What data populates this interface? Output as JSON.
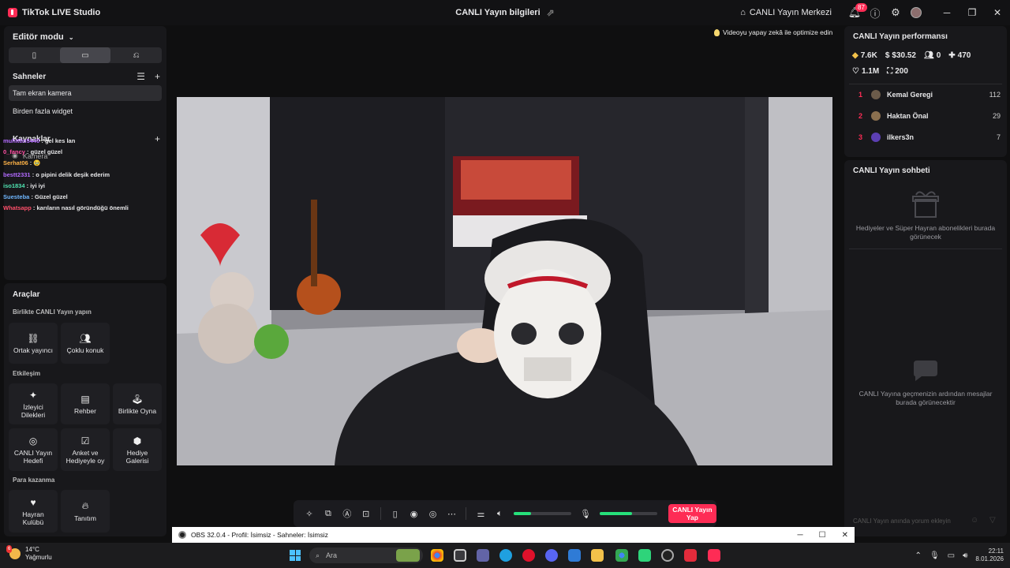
{
  "app": {
    "title": "TikTok LIVE Studio"
  },
  "header": {
    "center_title": "CANLI Yayın bilgileri",
    "live_center": "CANLI Yayın Merkezi",
    "notification_count": "87"
  },
  "editor": {
    "mode_label": "Editör modu",
    "scenes_title": "Sahneler",
    "scenes": [
      "Tam ekran kamera",
      "Birden fazla widget"
    ],
    "sources_title": "Kaynaklar",
    "source_camera": "Kamera"
  },
  "chat_overlay": [
    {
      "user": "muhittin5440",
      "text": "gel kes lan",
      "color": "#b36bff"
    },
    {
      "user": "0_fancy",
      "text": "güzel güzel",
      "color": "#ff4fa3"
    },
    {
      "user": "Serhat06",
      "text": "🥹",
      "color": "#ffb347"
    },
    {
      "user": "bestt2331",
      "text": "o pipini delik deşik ederim",
      "color": "#b36bff"
    },
    {
      "user": "iso1834",
      "text": "iyi iyi",
      "color": "#4fe3b0"
    },
    {
      "user": "Suesteba",
      "text": "Güzel güzel",
      "color": "#6fb7ff"
    },
    {
      "user": "Whatsapp",
      "text": "karıların nasıl göründüğü önemli",
      "color": "#ff4f6a"
    }
  ],
  "tools": {
    "title": "Araçlar",
    "group1": "Birlikte CANLI Yayın yapın",
    "group1_items": [
      "Ortak yayıncı",
      "Çoklu konuk"
    ],
    "group2": "Etkileşim",
    "group2_items": [
      "İzleyici Dilekleri",
      "Rehber",
      "Birlikte Oyna",
      "CANLI Yayın Hedefi",
      "Anket ve Hediyeyle oy",
      "Hediye Galerisi"
    ],
    "group3": "Para kazanma",
    "group3_items": [
      "Hayran Kulübü",
      "Tanıtım"
    ]
  },
  "optimize_hint": "Videoyu yapay zekâ ile optimize edin",
  "controls": {
    "go_live_line1": "CANLI Yayın",
    "go_live_line2": "Yap",
    "volume_level": 0.3,
    "mic_level": 0.57
  },
  "performance": {
    "title": "CANLI Yayın performansı",
    "diamonds": "7.6K",
    "earnings": "$30.52",
    "viewers": "0",
    "followers": "470",
    "likes": "1.1M",
    "gifts": "200",
    "ranking": [
      {
        "rank": "1",
        "name": "Kemal Geregi",
        "score": "112",
        "color": "#6b5b4a"
      },
      {
        "rank": "2",
        "name": "Haktan Önal",
        "score": "29",
        "color": "#8a6f4f"
      },
      {
        "rank": "3",
        "name": "ilkers3n",
        "score": "7",
        "color": "#5c3fb3"
      }
    ]
  },
  "live_chat": {
    "title": "CANLI Yayın sohbeti",
    "gifts_empty": "Hediyeler ve Süper Hayran abonelikleri burada görünecek",
    "messages_empty": "CANLI Yayına geçmenizin ardından mesajlar burada görünecektir",
    "input_placeholder": "CANLI Yayın anında yorum ekleyin"
  },
  "obs": {
    "title": "OBS 32.0.4 - Profil: İsimsiz - Sahneler: İsimsiz"
  },
  "taskbar": {
    "weather_temp": "14°C",
    "weather_text": "Yağmurlu",
    "weather_badge": "6",
    "search_placeholder": "Ara",
    "time": "22:11",
    "date": "8.01.2026"
  }
}
